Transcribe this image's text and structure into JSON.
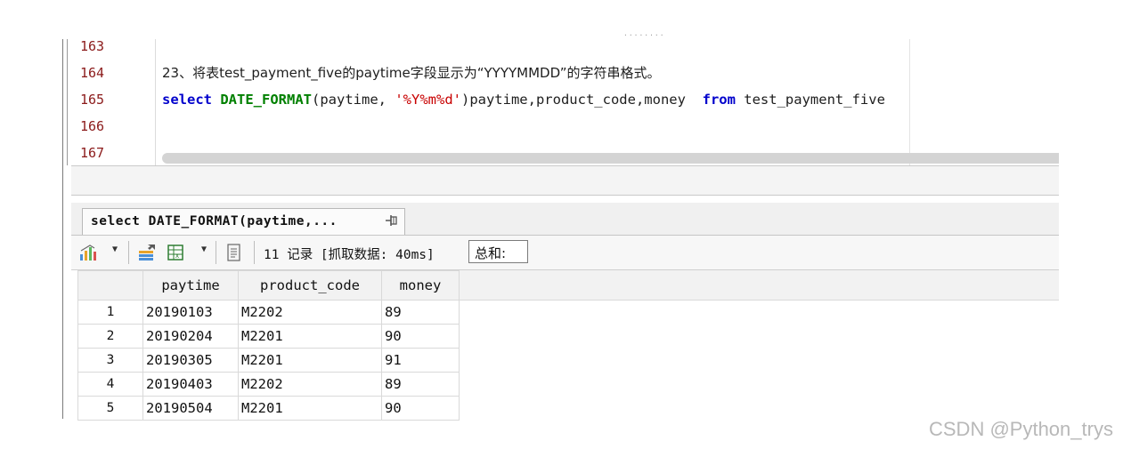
{
  "editor": {
    "lines": [
      {
        "num": "163"
      },
      {
        "num": "164",
        "comment": "23、将表test_payment_five的paytime字段显示为“YYYYMMDD”的字符串格式。"
      },
      {
        "num": "165",
        "kw_select": "select",
        "fn_name": "DATE_FORMAT",
        "arg1": "(paytime, ",
        "arg2": "'%Y%m%d'",
        "rest": ")paytime,product_code,money  ",
        "kw_from": "from",
        "table": " test_payment_five"
      },
      {
        "num": "166"
      },
      {
        "num": "167"
      }
    ]
  },
  "result_tab": {
    "label": "select DATE_FORMAT(paytime,...",
    "pin_icon": "pin-icon"
  },
  "toolbar": {
    "record_count": "11 记录 [抓取数据: 40ms]",
    "sum_label": "总和:",
    "icons": [
      "chart-icon",
      "dropdown-arrow",
      "export-icon",
      "excel-export-icon",
      "dropdown-arrow",
      "notes-icon"
    ]
  },
  "grid": {
    "columns": [
      "",
      "paytime",
      "product_code",
      "money"
    ],
    "rows": [
      [
        "1",
        "20190103",
        "M2202",
        "89"
      ],
      [
        "2",
        "20190204",
        "M2201",
        "90"
      ],
      [
        "3",
        "20190305",
        "M2201",
        "91"
      ],
      [
        "4",
        "20190403",
        "M2202",
        "89"
      ],
      [
        "5",
        "20190504",
        "M2201",
        "90"
      ]
    ]
  },
  "watermark": "CSDN @Python_trys",
  "colors": {
    "keyword": "#0000cc",
    "function": "#008000",
    "string": "#c80000",
    "line_number": "#8b1a1a"
  }
}
